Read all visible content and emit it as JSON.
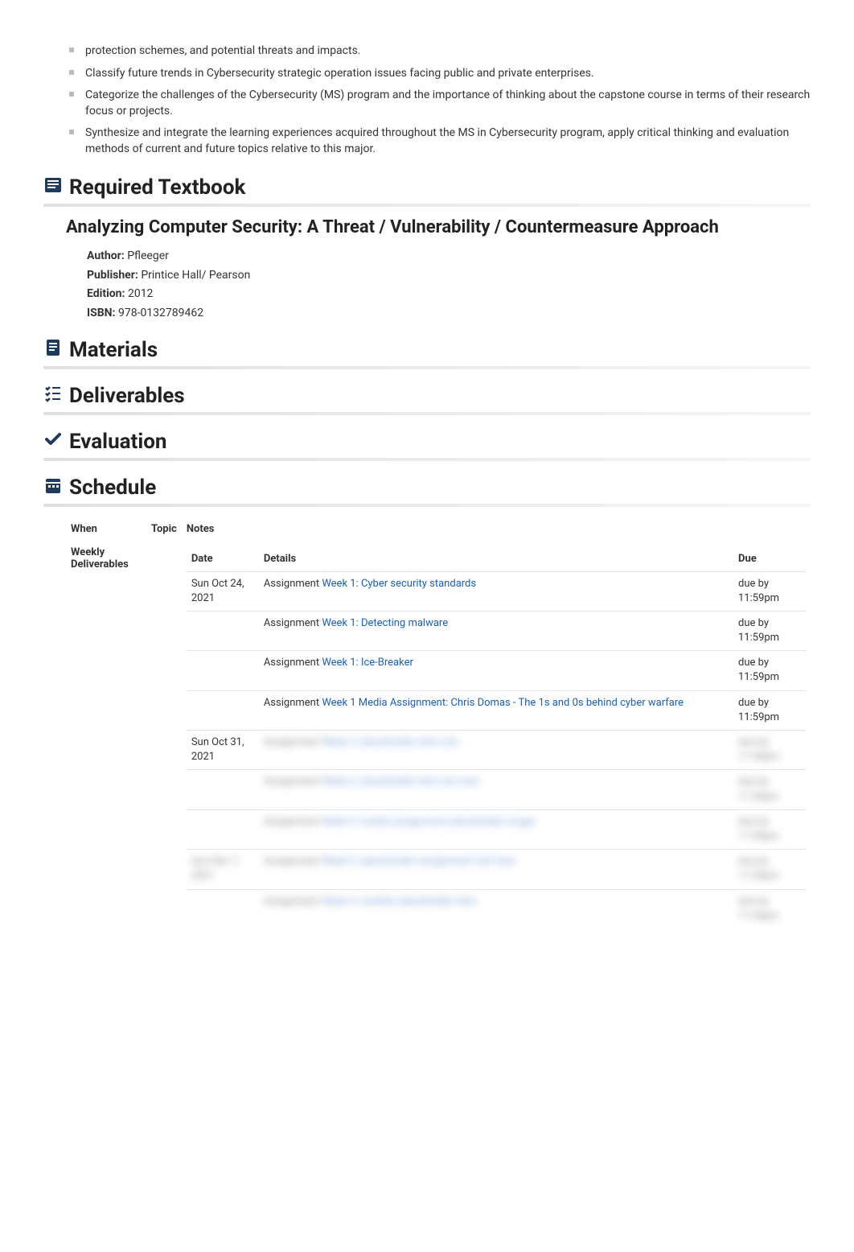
{
  "outcomes": [
    "protection schemes, and potential threats and impacts.",
    "Classify future trends in Cybersecurity strategic operation issues facing public and private enterprises.",
    "Categorize the challenges of the Cybersecurity (MS) program and the importance of thinking about the capstone course in terms of their research focus or projects.",
    "Synthesize and integrate the learning experiences acquired throughout the MS in Cybersecurity program, apply critical thinking and evaluation methods of current and future topics relative to this major."
  ],
  "sections": {
    "textbook_heading": "Required Textbook",
    "materials_heading": "Materials",
    "deliverables_heading": "Deliverables",
    "evaluation_heading": "Evaluation",
    "schedule_heading": "Schedule"
  },
  "textbook": {
    "title": "Analyzing Computer Security: A Threat / Vulnerability / Countermeasure Approach",
    "author_label": "Author:",
    "author": "Pfleeger",
    "publisher_label": "Publisher:",
    "publisher": "Printice Hall/ Pearson",
    "edition_label": "Edition:",
    "edition": "2012",
    "isbn_label": "ISBN:",
    "isbn": "978-0132789462"
  },
  "schedule": {
    "headers": {
      "when": "When",
      "topic": "Topic",
      "notes": "Notes"
    },
    "weekly_label": "Weekly Deliverables",
    "inner_headers": {
      "date": "Date",
      "details": "Details",
      "due": "Due"
    },
    "rows": [
      {
        "date": "Sun Oct 24, 2021",
        "items": [
          {
            "type": "Assignment",
            "title": "Week 1: Cyber security standards",
            "due": "due by 11:59pm",
            "blurred": false
          },
          {
            "type": "Assignment",
            "title": "Week 1: Detecting malware",
            "due": "due by 11:59pm",
            "blurred": false
          },
          {
            "type": "Assignment",
            "title": "Week 1: Ice-Breaker",
            "due": "due by 11:59pm",
            "blurred": false
          },
          {
            "type": "Assignment",
            "title": "Week 1 Media Assignment: Chris Domas - The 1s and 0s behind cyber warfare",
            "due": "due by 11:59pm",
            "blurred": false
          }
        ]
      },
      {
        "date": "Sun Oct 31, 2021",
        "items": [
          {
            "type": "Assignment",
            "title": "Week 2: placeholder item one",
            "due": "due by 11:59pm",
            "blurred": true
          },
          {
            "type": "Assignment",
            "title": "Week 2: placeholder item two text",
            "due": "due by 11:59pm",
            "blurred": true
          },
          {
            "type": "Assignment",
            "title": "Week 2: media assignment placeholder longer",
            "due": "due by 11:59pm",
            "blurred": true
          }
        ]
      },
      {
        "date": "Sun Nov 7, 2021",
        "date_blurred": true,
        "items": [
          {
            "type": "Assignment",
            "title": "Week 3: placeholder assignment text here",
            "due": "due by 11:59pm",
            "blurred": true
          },
          {
            "type": "Assignment",
            "title": "Week 3: another placeholder item",
            "due": "due by 11:59pm",
            "blurred": true
          }
        ]
      }
    ]
  }
}
